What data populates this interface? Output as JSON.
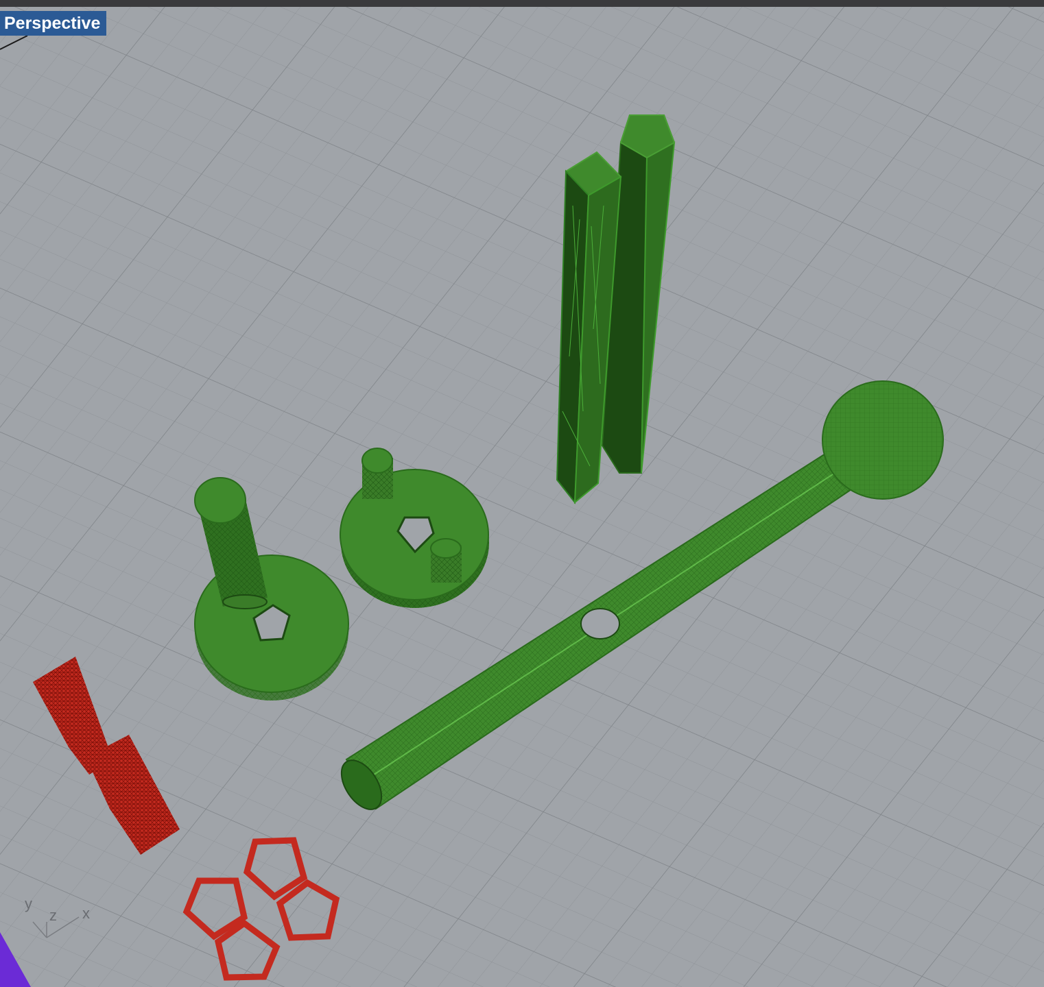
{
  "window": {
    "title_bar_color": "#3a3a3c"
  },
  "viewport": {
    "name": "Perspective",
    "background_color": "#a0a4a9",
    "grid_line_color": "#8d9196",
    "label_color": "#2b5a95"
  },
  "axis_indicator": {
    "x": "x",
    "y": "y",
    "z": "z"
  },
  "objects": {
    "green_color": "#3f8a2c",
    "red_color": "#c42a1f",
    "purple_color": "#6b2bd6"
  }
}
